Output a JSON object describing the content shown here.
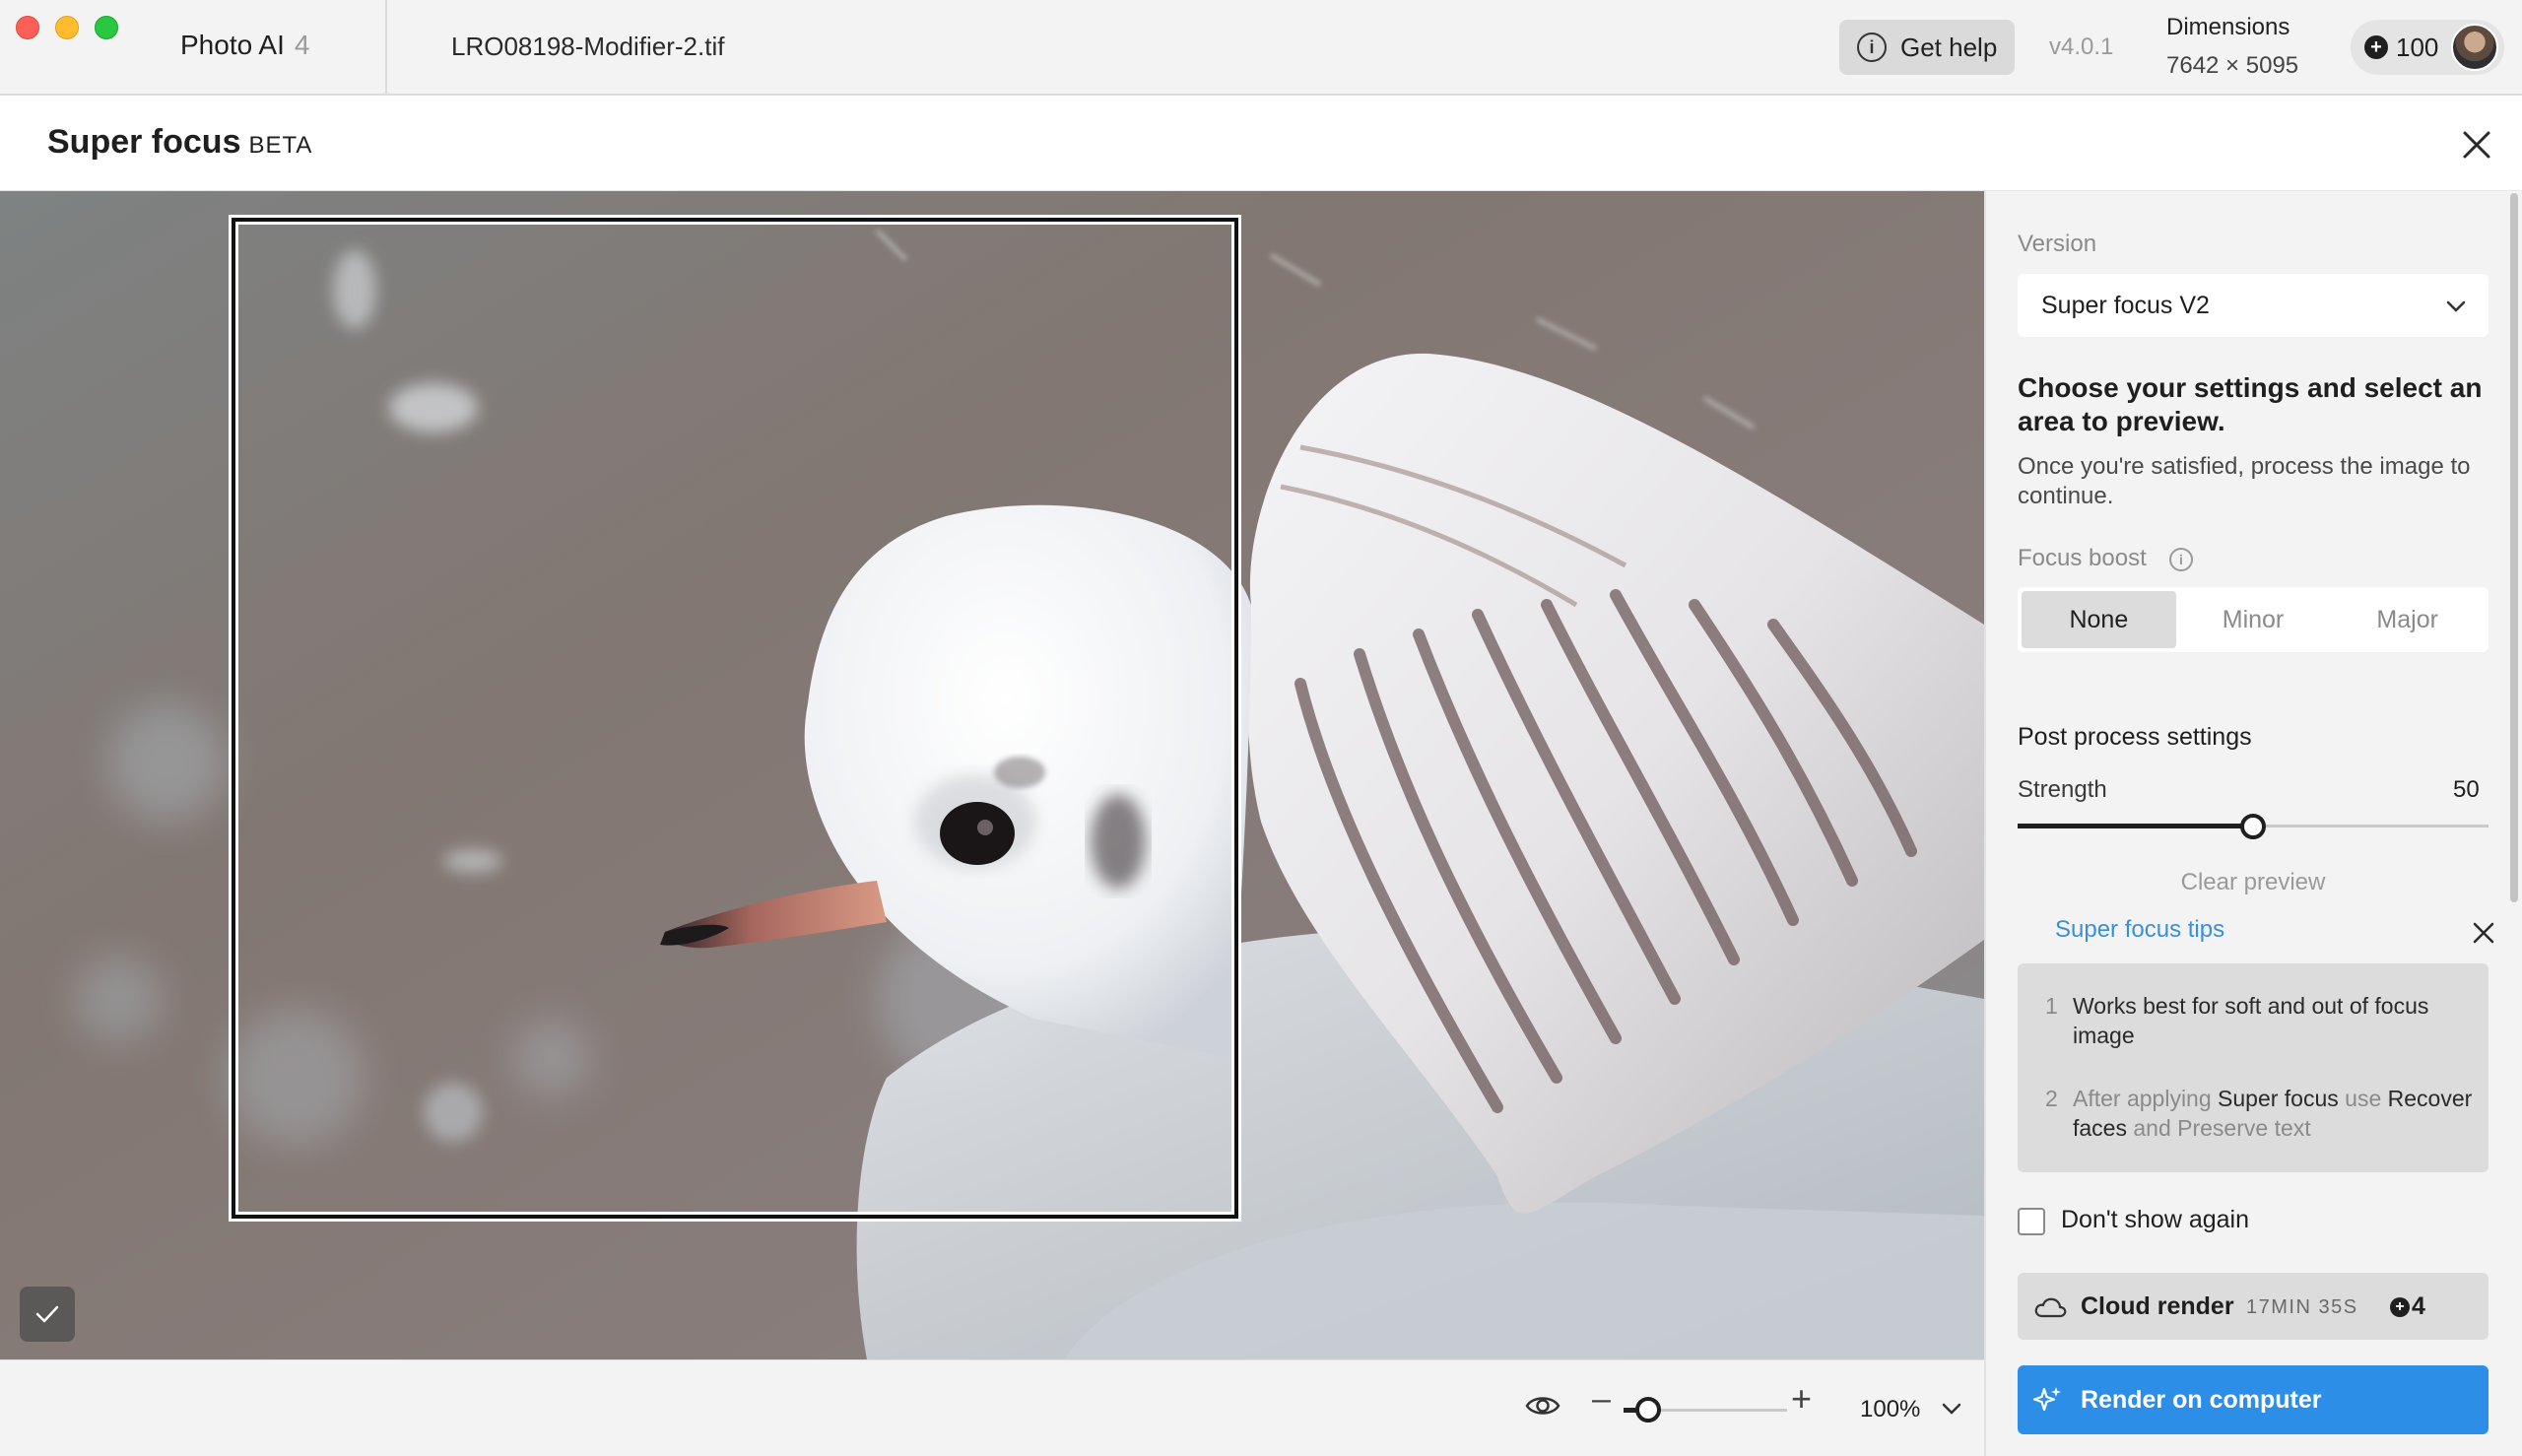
{
  "titlebar": {
    "app_name": "Photo AI",
    "app_version_number": "4",
    "filename": "LRO08198-Modifier-2.tif",
    "help_label": "Get help",
    "version": "v4.0.1",
    "dimensions_label": "Dimensions",
    "dimensions_value": "7642 × 5095",
    "credits": "100"
  },
  "tool": {
    "title": "Super focus",
    "badge": "BETA"
  },
  "bottombar": {
    "zoom_value": "100%",
    "zoom_level": 1.0
  },
  "panel": {
    "version_label": "Version",
    "version_value": "Super focus V2",
    "heading": "Choose your settings and select an area to preview.",
    "subtext": "Once you're satisfied, process the image to continue.",
    "focus_boost_label": "Focus boost",
    "focus_boost_options": [
      "None",
      "Minor",
      "Major"
    ],
    "focus_boost_selected": "None",
    "post_process_title": "Post process settings",
    "strength_label": "Strength",
    "strength_value": "50",
    "clear_preview": "Clear preview",
    "tips_link": "Super focus tips",
    "tips": [
      {
        "number": "1",
        "text": "Works best for soft and out of focus image"
      },
      {
        "number": "2",
        "parts": [
          "After applying ",
          "Super focus",
          " use ",
          "Recover faces",
          " and ",
          "Preserve text"
        ]
      }
    ],
    "dont_show_again": "Don't show again",
    "cloud_render": {
      "label": "Cloud render",
      "time": "17MIN 35S",
      "credits": "4"
    },
    "render_on_computer": "Render on computer"
  },
  "colors": {
    "accent_blue": "#2d8ee8",
    "link_blue": "#3a8fd8",
    "panel_bg": "#f3f3f3"
  },
  "icons": {
    "info": "info-icon",
    "close": "close-icon",
    "eye": "eye-icon",
    "chevron": "chevron-down-icon",
    "cloud": "cloud-icon",
    "sparkle": "sparkle-icon",
    "check": "check-icon",
    "credit": "credit-coin-icon"
  }
}
